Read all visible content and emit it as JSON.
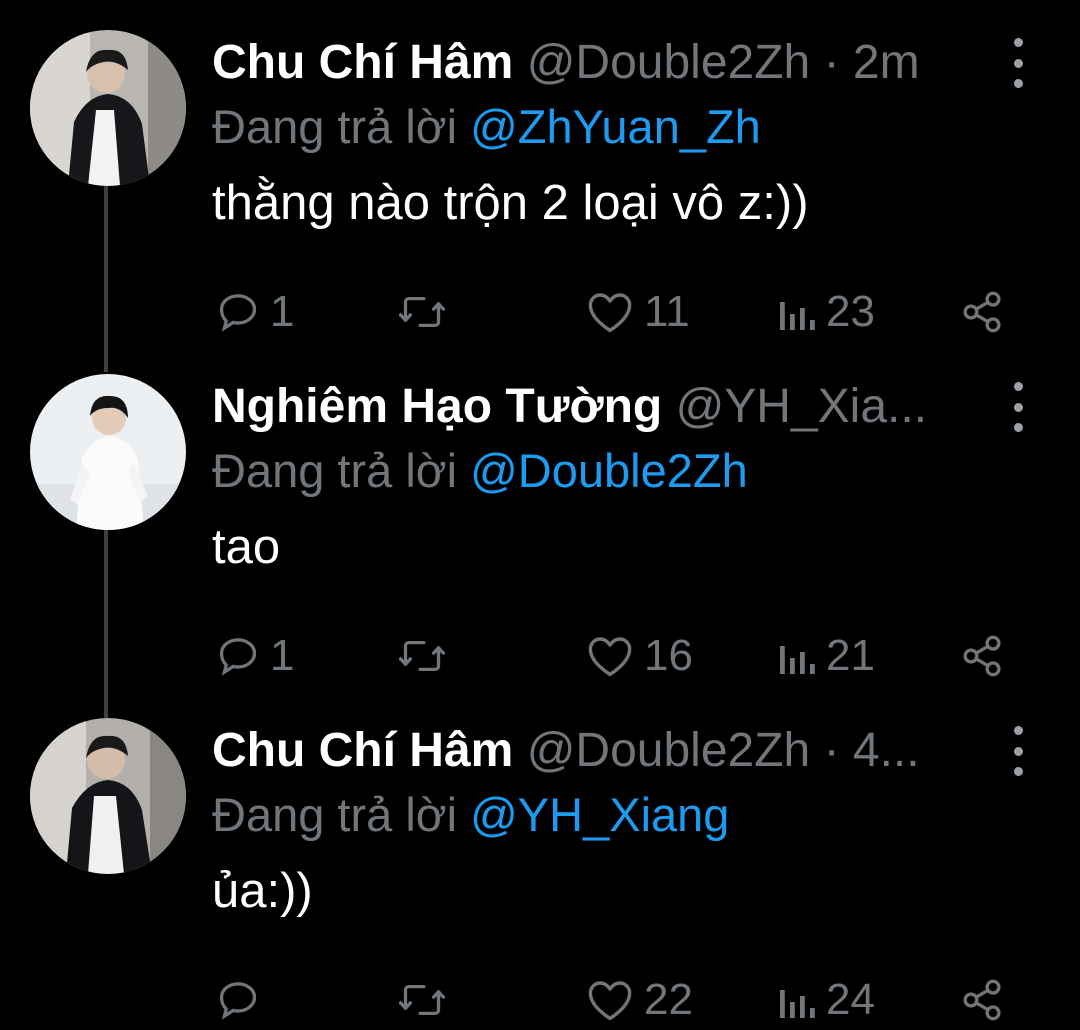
{
  "tweets": [
    {
      "name": "Chu Chí Hâm",
      "handle": "@Double2Zh",
      "time": " · 2m",
      "reply_prefix": "Đang trả lời ",
      "reply_mention": "@ZhYuan_Zh",
      "text": "thằng nào trộn 2 loại vô z:))",
      "replies": "1",
      "retweets": "",
      "likes": "11",
      "views": "23"
    },
    {
      "name": "Nghiêm Hạo Tường",
      "handle": "@YH_Xia...",
      "time": "",
      "reply_prefix": "Đang trả lời ",
      "reply_mention": "@Double2Zh",
      "text": "tao",
      "replies": "1",
      "retweets": "",
      "likes": "16",
      "views": "21"
    },
    {
      "name": "Chu Chí Hâm",
      "handle": "@Double2Zh",
      "time": " · 4...",
      "reply_prefix": "Đang trả lời ",
      "reply_mention": "@YH_Xiang",
      "text": "ủa:))",
      "replies": "",
      "retweets": "",
      "likes": "22",
      "views": "24"
    }
  ],
  "colors": {
    "background": "#000000",
    "text": "#ffffff",
    "muted": "#71767b",
    "mention": "#1d9bf0",
    "thread_line": "#3b3f44"
  },
  "icons": {
    "reply": "speech-bubble-icon",
    "retweet": "retweet-arrows-icon",
    "like": "heart-icon",
    "views": "bar-chart-icon",
    "share": "share-icon",
    "more": "vertical-dots-icon"
  }
}
